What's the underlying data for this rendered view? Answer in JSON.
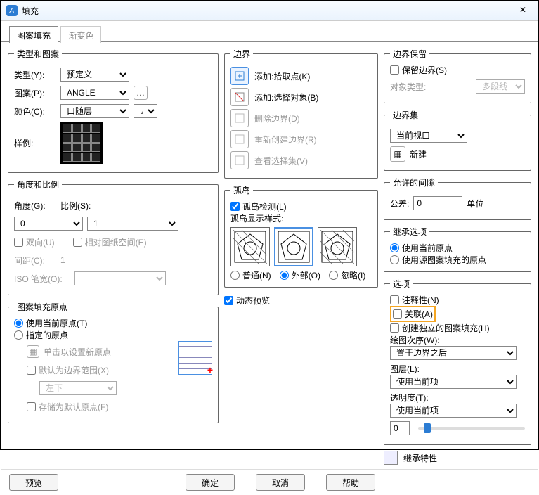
{
  "window": {
    "title": "填充",
    "close": "✕"
  },
  "tabs": {
    "active": "图案填充",
    "inactive": "渐变色"
  },
  "typeGroup": {
    "legend": "类型和图案",
    "typeLabel": "类型(Y):",
    "typeValue": "预定义",
    "patternLabel": "图案(P):",
    "patternValue": "ANGLE",
    "colorLabel": "颜色(C):",
    "colorValue": "口随层",
    "sampleLabel": "样例:"
  },
  "angleGroup": {
    "legend": "角度和比例",
    "angleLabel": "角度(G):",
    "angleValue": "0",
    "scaleLabel": "比例(S):",
    "scaleValue": "1",
    "bidirLabel": "双向(U)",
    "relPaperLabel": "相对图纸空间(E)",
    "spacingLabel": "间距(C):",
    "spacingValue": "1",
    "isoPenLabel": "ISO 笔宽(O):"
  },
  "originGroup": {
    "legend": "图案填充原点",
    "useCurrent": "使用当前原点(T)",
    "specify": "指定的原点",
    "clickSet": "单击以设置新原点",
    "defaultExtent": "默认为边界范围(X)",
    "defaultExtentVal": "左下",
    "storeDefault": "存储为默认原点(F)"
  },
  "boundary": {
    "legend": "边界",
    "addPick": "添加:拾取点(K)",
    "addSelect": "添加:选择对象(B)",
    "removeBoundary": "删除边界(D)",
    "recreate": "重新创建边界(R)",
    "viewSelection": "查看选择集(V)"
  },
  "islands": {
    "legend": "孤岛",
    "detect": "孤岛检测(L)",
    "styleLabel": "孤岛显示样式:",
    "normal": "普通(N)",
    "outer": "外部(O)",
    "ignore": "忽略(I)"
  },
  "dynamicPreview": "动态预览",
  "bRetain": {
    "legend": "边界保留",
    "retain": "保留边界(S)",
    "objTypeLabel": "对象类型:",
    "objTypeValue": "多段线"
  },
  "bSet": {
    "legend": "边界集",
    "value": "当前视口",
    "newBtn": "新建"
  },
  "gap": {
    "legend": "允许的间隙",
    "tolLabel": "公差:",
    "tolValue": "0",
    "unit": "单位"
  },
  "inheritOpt": {
    "legend": "继承选项",
    "useCurrent": "使用当前原点",
    "useSource": "使用源图案填充的原点"
  },
  "options": {
    "legend": "选项",
    "annotative": "注释性(N)",
    "associative": "关联(A)",
    "independent": "创建独立的图案填充(H)",
    "drawOrderLabel": "绘图次序(W):",
    "drawOrderValue": "置于边界之后",
    "layerLabel": "图层(L):",
    "layerValue": "使用当前项",
    "transLabel": "透明度(T):",
    "transValue": "使用当前项",
    "transNum": "0"
  },
  "inheritProps": "继承特性",
  "buttons": {
    "preview": "预览",
    "ok": "确定",
    "cancel": "取消",
    "help": "帮助"
  }
}
